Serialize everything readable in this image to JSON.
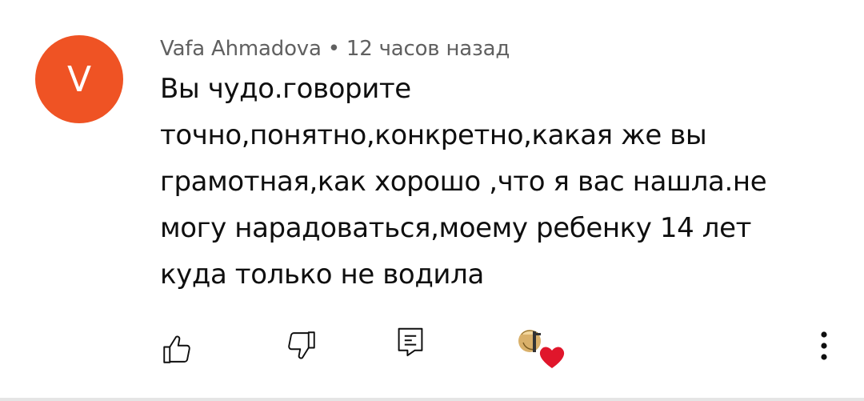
{
  "comment": {
    "avatar_letter": "V",
    "avatar_color": "#ef5324",
    "author": "Vafa Ahmadova",
    "separator": "•",
    "time": "12 часов назад",
    "text_lines": [
      "Вы чудо.говорите",
      "точно,понятно,конкретно,какая же вы",
      "грамотная,как хорошо ,что я вас нашла.не",
      "могу нарадоваться,моему ребенку 14 лет",
      "куда только не водила"
    ]
  },
  "actions": {
    "like_icon": "thumbs-up-icon",
    "dislike_icon": "thumbs-down-icon",
    "reply_icon": "comment-reply-icon",
    "creator_heart_icon": "creator-heart-icon",
    "more_icon": "more-vertical-icon",
    "heart_color": "#e0162b"
  }
}
